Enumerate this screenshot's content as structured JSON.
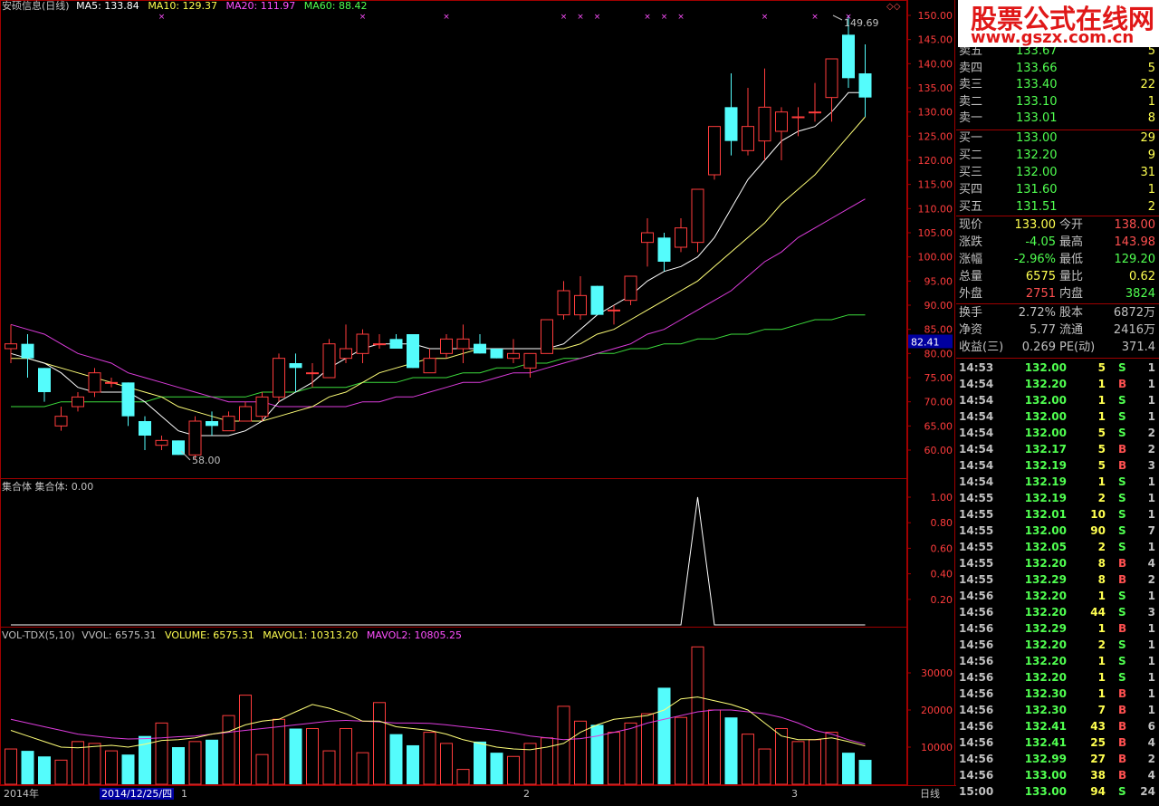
{
  "header": {
    "title": "安硕信息(日线)",
    "ma": [
      {
        "label": "MA5: 133.84",
        "color": "#ffffff"
      },
      {
        "label": "MA10: 129.37",
        "color": "#ffff50"
      },
      {
        "label": "MA20: 111.97",
        "color": "#ff50ff"
      },
      {
        "label": "MA60: 88.42",
        "color": "#50ff50"
      }
    ]
  },
  "price_axis": [
    "150.00",
    "145.00",
    "140.00",
    "135.00",
    "130.00",
    "125.00",
    "120.00",
    "115.00",
    "110.00",
    "105.00",
    "100.00",
    "95.00",
    "90.00",
    "85.00",
    "82.41",
    "80.00",
    "75.00",
    "70.00",
    "65.00",
    "60.00"
  ],
  "annotations": {
    "high": "149.69",
    "low": "58.00"
  },
  "indicator": {
    "title": "集合体 集合体: 0.00",
    "axis": [
      "1.00",
      "0.80",
      "0.60",
      "0.40",
      "0.20"
    ]
  },
  "volume_panel": {
    "title": "VOL-TDX(5,10)",
    "items": [
      {
        "label": "VVOL: 6575.31",
        "color": "#c0c0c0"
      },
      {
        "label": "VOLUME: 6575.31",
        "color": "#ffff50"
      },
      {
        "label": "MAVOL1: 10313.20",
        "color": "#ffff50"
      },
      {
        "label": "MAVOL2: 10805.25",
        "color": "#ff50ff"
      }
    ],
    "axis": [
      "30000",
      "20000",
      "10000"
    ]
  },
  "bottom_bar": {
    "year": "2014年",
    "date": "2014/12/25/四",
    "m1": "1",
    "m2": "2",
    "m3": "3",
    "period": "日线"
  },
  "watermark": {
    "line1": "股票公式在线网",
    "line2": "www.gszx.com.cn"
  },
  "order_book": {
    "sell": [
      {
        "label": "卖五",
        "price": "133.67",
        "vol": "5"
      },
      {
        "label": "卖四",
        "price": "133.66",
        "vol": "5"
      },
      {
        "label": "卖三",
        "price": "133.40",
        "vol": "22"
      },
      {
        "label": "卖二",
        "price": "133.10",
        "vol": "1"
      },
      {
        "label": "卖一",
        "price": "133.01",
        "vol": "8"
      }
    ],
    "buy": [
      {
        "label": "买一",
        "price": "133.00",
        "vol": "29"
      },
      {
        "label": "买二",
        "price": "132.20",
        "vol": "9"
      },
      {
        "label": "买三",
        "price": "132.00",
        "vol": "31"
      },
      {
        "label": "买四",
        "price": "131.60",
        "vol": "1"
      },
      {
        "label": "买五",
        "price": "131.51",
        "vol": "2"
      }
    ]
  },
  "quote": [
    {
      "l1": "现价",
      "v1": "133.00",
      "c1": "#ffff50",
      "l2": "今开",
      "v2": "138.00",
      "c2": "#ff5050"
    },
    {
      "l1": "涨跌",
      "v1": "-4.05",
      "c1": "#50ff50",
      "l2": "最高",
      "v2": "143.98",
      "c2": "#ff5050"
    },
    {
      "l1": "涨幅",
      "v1": "-2.96%",
      "c1": "#50ff50",
      "l2": "最低",
      "v2": "129.20",
      "c2": "#50ff50"
    },
    {
      "l1": "总量",
      "v1": "6575",
      "c1": "#ffff50",
      "l2": "量比",
      "v2": "0.62",
      "c2": "#ffff50"
    },
    {
      "l1": "外盘",
      "v1": "2751",
      "c1": "#ff5050",
      "l2": "内盘",
      "v2": "3824",
      "c2": "#50ff50"
    }
  ],
  "finance": [
    {
      "l1": "换手",
      "v1": "2.72%",
      "l2": "股本",
      "v2": "6872万"
    },
    {
      "l1": "净资",
      "v1": "5.77",
      "l2": "流通",
      "v2": "2416万"
    },
    {
      "l1": "收益(三)",
      "v1": "0.269",
      "l2": "PE(动)",
      "v2": "371.4"
    }
  ],
  "ticks": [
    {
      "time": "14:53",
      "price": "132.00",
      "vol": "5",
      "bs": "S",
      "n": "1"
    },
    {
      "time": "14:54",
      "price": "132.20",
      "vol": "1",
      "bs": "B",
      "n": "1"
    },
    {
      "time": "14:54",
      "price": "132.00",
      "vol": "1",
      "bs": "S",
      "n": "1"
    },
    {
      "time": "14:54",
      "price": "132.00",
      "vol": "1",
      "bs": "S",
      "n": "1"
    },
    {
      "time": "14:54",
      "price": "132.00",
      "vol": "5",
      "bs": "S",
      "n": "2"
    },
    {
      "time": "14:54",
      "price": "132.17",
      "vol": "5",
      "bs": "B",
      "n": "2"
    },
    {
      "time": "14:54",
      "price": "132.19",
      "vol": "5",
      "bs": "B",
      "n": "3"
    },
    {
      "time": "14:54",
      "price": "132.19",
      "vol": "1",
      "bs": "S",
      "n": "1"
    },
    {
      "time": "14:55",
      "price": "132.19",
      "vol": "2",
      "bs": "S",
      "n": "1"
    },
    {
      "time": "14:55",
      "price": "132.01",
      "vol": "10",
      "bs": "S",
      "n": "1"
    },
    {
      "time": "14:55",
      "price": "132.00",
      "vol": "90",
      "bs": "S",
      "n": "7"
    },
    {
      "time": "14:55",
      "price": "132.05",
      "vol": "2",
      "bs": "S",
      "n": "1"
    },
    {
      "time": "14:55",
      "price": "132.20",
      "vol": "8",
      "bs": "B",
      "n": "4"
    },
    {
      "time": "14:55",
      "price": "132.29",
      "vol": "8",
      "bs": "B",
      "n": "2"
    },
    {
      "time": "14:56",
      "price": "132.20",
      "vol": "1",
      "bs": "S",
      "n": "1"
    },
    {
      "time": "14:56",
      "price": "132.20",
      "vol": "44",
      "bs": "S",
      "n": "3"
    },
    {
      "time": "14:56",
      "price": "132.29",
      "vol": "1",
      "bs": "B",
      "n": "1"
    },
    {
      "time": "14:56",
      "price": "132.20",
      "vol": "2",
      "bs": "S",
      "n": "1"
    },
    {
      "time": "14:56",
      "price": "132.20",
      "vol": "1",
      "bs": "S",
      "n": "1"
    },
    {
      "time": "14:56",
      "price": "132.20",
      "vol": "1",
      "bs": "S",
      "n": "1"
    },
    {
      "time": "14:56",
      "price": "132.30",
      "vol": "1",
      "bs": "B",
      "n": "1"
    },
    {
      "time": "14:56",
      "price": "132.30",
      "vol": "7",
      "bs": "B",
      "n": "1"
    },
    {
      "time": "14:56",
      "price": "132.41",
      "vol": "43",
      "bs": "B",
      "n": "6"
    },
    {
      "time": "14:56",
      "price": "132.41",
      "vol": "25",
      "bs": "B",
      "n": "4"
    },
    {
      "time": "14:56",
      "price": "132.99",
      "vol": "27",
      "bs": "B",
      "n": "2"
    },
    {
      "time": "14:56",
      "price": "133.00",
      "vol": "38",
      "bs": "B",
      "n": "4"
    },
    {
      "time": "15:00",
      "price": "133.00",
      "vol": "94",
      "bs": "S",
      "n": "24"
    }
  ],
  "chart_data": {
    "type": "candlestick",
    "title": "安硕信息(日线)",
    "ylim": [
      55,
      152
    ],
    "candles": [
      {
        "o": 81,
        "h": 86,
        "l": 78,
        "c": 82
      },
      {
        "o": 82,
        "h": 84,
        "l": 75,
        "c": 79
      },
      {
        "o": 77,
        "h": 77,
        "l": 70,
        "c": 72
      },
      {
        "o": 65,
        "h": 69,
        "l": 64,
        "c": 67
      },
      {
        "o": 69,
        "h": 72,
        "l": 68,
        "c": 71
      },
      {
        "o": 72,
        "h": 77,
        "l": 71,
        "c": 76
      },
      {
        "o": 74,
        "h": 75,
        "l": 73,
        "c": 74
      },
      {
        "o": 74,
        "h": 74,
        "l": 65,
        "c": 67
      },
      {
        "o": 66,
        "h": 67,
        "l": 60,
        "c": 63
      },
      {
        "o": 61,
        "h": 63,
        "l": 60,
        "c": 62
      },
      {
        "o": 62,
        "h": 62,
        "l": 59,
        "c": 59
      },
      {
        "o": 59,
        "h": 67,
        "l": 58,
        "c": 66
      },
      {
        "o": 66,
        "h": 68,
        "l": 63,
        "c": 65
      },
      {
        "o": 64,
        "h": 68,
        "l": 64,
        "c": 67
      },
      {
        "o": 66,
        "h": 70,
        "l": 66,
        "c": 69
      },
      {
        "o": 67,
        "h": 72,
        "l": 66,
        "c": 71
      },
      {
        "o": 71,
        "h": 80,
        "l": 70,
        "c": 79
      },
      {
        "o": 78,
        "h": 80,
        "l": 72,
        "c": 77
      },
      {
        "o": 76,
        "h": 78,
        "l": 73,
        "c": 76
      },
      {
        "o": 75,
        "h": 83,
        "l": 75,
        "c": 82
      },
      {
        "o": 79,
        "h": 86,
        "l": 78,
        "c": 81
      },
      {
        "o": 80,
        "h": 85,
        "l": 78,
        "c": 84
      },
      {
        "o": 82,
        "h": 84,
        "l": 81,
        "c": 82
      },
      {
        "o": 83,
        "h": 84,
        "l": 81,
        "c": 81
      },
      {
        "o": 84,
        "h": 84,
        "l": 77,
        "c": 77
      },
      {
        "o": 76,
        "h": 81,
        "l": 76,
        "c": 79
      },
      {
        "o": 80,
        "h": 84,
        "l": 79,
        "c": 83
      },
      {
        "o": 81,
        "h": 86,
        "l": 78,
        "c": 83
      },
      {
        "o": 82,
        "h": 84,
        "l": 80,
        "c": 80
      },
      {
        "o": 81,
        "h": 81,
        "l": 79,
        "c": 79
      },
      {
        "o": 79,
        "h": 83,
        "l": 78,
        "c": 80
      },
      {
        "o": 77,
        "h": 80,
        "l": 75,
        "c": 80
      },
      {
        "o": 80,
        "h": 87,
        "l": 80,
        "c": 87
      },
      {
        "o": 88,
        "h": 95,
        "l": 87,
        "c": 93
      },
      {
        "o": 88,
        "h": 96,
        "l": 87,
        "c": 92
      },
      {
        "o": 94,
        "h": 94,
        "l": 88,
        "c": 88
      },
      {
        "o": 89,
        "h": 90,
        "l": 86,
        "c": 89
      },
      {
        "o": 91,
        "h": 96,
        "l": 90,
        "c": 96
      },
      {
        "o": 103,
        "h": 108,
        "l": 98,
        "c": 105
      },
      {
        "o": 104,
        "h": 105,
        "l": 97,
        "c": 99
      },
      {
        "o": 102,
        "h": 108,
        "l": 101,
        "c": 106
      },
      {
        "o": 103,
        "h": 114,
        "l": 101,
        "c": 114
      },
      {
        "o": 117,
        "h": 127,
        "l": 116,
        "c": 127
      },
      {
        "o": 131,
        "h": 138,
        "l": 121,
        "c": 124
      },
      {
        "o": 122,
        "h": 135,
        "l": 121,
        "c": 127
      },
      {
        "o": 124,
        "h": 139,
        "l": 120,
        "c": 131
      },
      {
        "o": 126,
        "h": 131,
        "l": 120,
        "c": 130
      },
      {
        "o": 129,
        "h": 131,
        "l": 125,
        "c": 129
      },
      {
        "o": 130,
        "h": 136,
        "l": 128,
        "c": 130
      },
      {
        "o": 133,
        "h": 141,
        "l": 128,
        "c": 141
      },
      {
        "o": 146,
        "h": 150,
        "l": 135,
        "c": 137
      },
      {
        "o": 138,
        "h": 144,
        "l": 129,
        "c": 133
      }
    ],
    "ma5": [
      80,
      79,
      78,
      76,
      73,
      72,
      72,
      72,
      70,
      67,
      64,
      63,
      63,
      63,
      64,
      66,
      70,
      72,
      74,
      77,
      79,
      81,
      82,
      82,
      82,
      81,
      81,
      81,
      81,
      81,
      81,
      81,
      81,
      82,
      85,
      88,
      90,
      92,
      95,
      97,
      98,
      100,
      104,
      110,
      116,
      120,
      124,
      126,
      127,
      130,
      134,
      134
    ],
    "ma10": [
      79,
      79,
      78,
      77,
      76,
      75,
      74,
      73,
      72,
      71,
      69,
      68,
      67,
      66,
      66,
      66,
      67,
      68,
      69,
      71,
      72,
      74,
      76,
      77,
      78,
      79,
      79,
      80,
      81,
      81,
      81,
      81,
      81,
      81,
      82,
      84,
      85,
      87,
      89,
      91,
      93,
      95,
      98,
      101,
      104,
      107,
      111,
      114,
      117,
      121,
      125,
      129
    ],
    "ma20": [
      86,
      85,
      84,
      82,
      80,
      79,
      78,
      76,
      75,
      74,
      73,
      72,
      71,
      70,
      70,
      70,
      69,
      69,
      69,
      69,
      69,
      70,
      70,
      71,
      71,
      72,
      73,
      74,
      74,
      75,
      76,
      76,
      77,
      78,
      79,
      80,
      81,
      82,
      84,
      85,
      87,
      89,
      91,
      93,
      96,
      99,
      101,
      104,
      106,
      108,
      110,
      112
    ],
    "ma60": [
      69,
      69,
      69,
      70,
      70,
      70,
      70,
      70,
      70,
      71,
      71,
      71,
      71,
      71,
      71,
      72,
      72,
      72,
      73,
      73,
      73,
      74,
      74,
      74,
      75,
      75,
      75,
      76,
      76,
      77,
      77,
      78,
      78,
      79,
      79,
      80,
      80,
      81,
      81,
      82,
      82,
      83,
      83,
      84,
      84,
      85,
      85,
      86,
      87,
      87,
      88,
      88
    ],
    "volume": [
      9500,
      9000,
      7500,
      6500,
      11500,
      11000,
      9000,
      8000,
      13000,
      16500,
      10000,
      11500,
      12000,
      18500,
      24000,
      8000,
      17500,
      15000,
      15000,
      9000,
      15000,
      8500,
      22000,
      13500,
      10500,
      14000,
      11000,
      4000,
      11500,
      8500,
      7500,
      11000,
      12500,
      21000,
      17000,
      16000,
      14000,
      16500,
      19000,
      26000,
      18000,
      37000,
      20000,
      18000,
      13500,
      9500,
      15000,
      11500,
      12000,
      14000,
      8500,
      6575
    ],
    "mavol1": [
      14500,
      13000,
      11500,
      10000,
      9800,
      10200,
      10500,
      10000,
      10800,
      11800,
      12000,
      12500,
      13500,
      14200,
      16000,
      17000,
      17500,
      19500,
      21500,
      20500,
      19000,
      17000,
      17000,
      15500,
      15000,
      14500,
      13500,
      12000,
      11000,
      10000,
      9500,
      9300,
      10000,
      11000,
      14000,
      16000,
      17500,
      18000,
      18500,
      20000,
      23000,
      23500,
      22500,
      21500,
      20000,
      16500,
      13000,
      12000,
      12000,
      12500,
      11500,
      10313
    ],
    "mavol2": [
      17500,
      16500,
      15500,
      14500,
      13500,
      13000,
      12500,
      12200,
      12300,
      12500,
      12800,
      13000,
      13500,
      14000,
      14500,
      15000,
      15500,
      16000,
      16500,
      17000,
      17200,
      17000,
      16800,
      16500,
      16500,
      16400,
      16000,
      15500,
      15000,
      14500,
      13800,
      13000,
      12500,
      12000,
      12300,
      13000,
      14000,
      15000,
      16500,
      17500,
      18500,
      19500,
      20000,
      20000,
      19500,
      19000,
      18000,
      16500,
      14500,
      13500,
      12000,
      10805
    ],
    "indicator": [
      0,
      0,
      0,
      0,
      0,
      0,
      0,
      0,
      0,
      0,
      0,
      0,
      0,
      0,
      0,
      0,
      0,
      0,
      0,
      0,
      0,
      0,
      0,
      0,
      0,
      0,
      0,
      0,
      0,
      0,
      0,
      0,
      0,
      0,
      0,
      0,
      0,
      0,
      0,
      0,
      0,
      1,
      0,
      0,
      0,
      0,
      0,
      0,
      0,
      0,
      0,
      0
    ],
    "markers": [
      9,
      21,
      26,
      33,
      34,
      35,
      38,
      39,
      40,
      45,
      48,
      50
    ]
  }
}
